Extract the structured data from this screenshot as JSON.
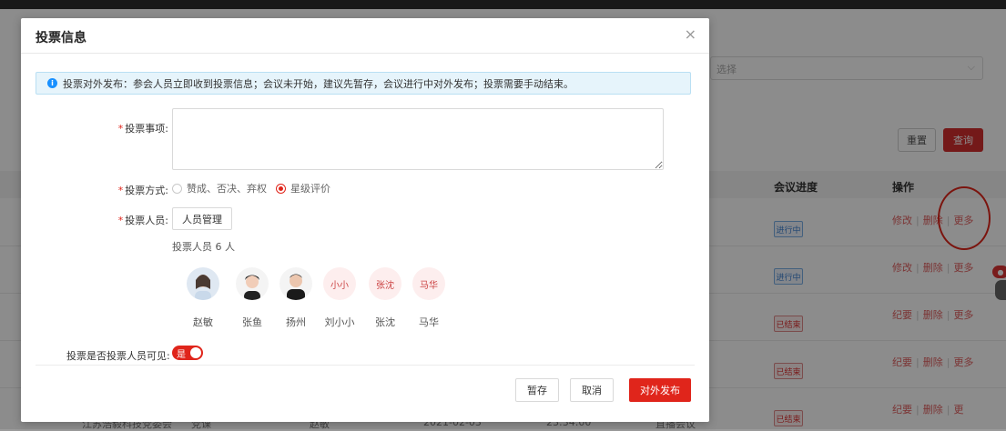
{
  "background": {
    "select_placeholder": "选择",
    "reset_label": "重置",
    "query_label": "查询",
    "columns": {
      "progress": "会议进度",
      "action": "操作"
    },
    "rows": [
      {
        "status": "进行中",
        "actions": [
          "修改",
          "删除",
          "更多"
        ]
      },
      {
        "status": "进行中",
        "actions": [
          "修改",
          "删除",
          "更多"
        ]
      },
      {
        "status": "已结束",
        "actions": [
          "纪要",
          "删除",
          "更多"
        ]
      },
      {
        "status": "已结束",
        "actions": [
          "纪要",
          "删除",
          "更多"
        ]
      },
      {
        "status": "已结束",
        "actions": [
          "纪要",
          "删除",
          "更"
        ]
      }
    ],
    "bottom_row": {
      "org": "江苏浩毅科技党委会",
      "type": "党课",
      "person": "赵敏",
      "date": "2021-02-03",
      "time": "23:34:00",
      "mode": "直播会议"
    }
  },
  "modal": {
    "title": "投票信息",
    "close": "×",
    "alert": "投票对外发布：参会人员立即收到投票信息；会议未开始，建议先暂存，会议进行中对外发布；投票需要手动结束。",
    "fields": {
      "item_label": "投票事项:",
      "method_label": "投票方式:",
      "method_options": [
        "赞成、否决、弃权",
        "星级评价"
      ],
      "method_selected": 1,
      "people_label": "投票人员:",
      "manage_btn": "人员管理",
      "count_text": "投票人员 6 人",
      "visibility_label": "投票是否投票人员可见:",
      "visibility_toggle": "是"
    },
    "people": [
      {
        "avatar": "photo",
        "avatar_text": "",
        "name": "赵敏"
      },
      {
        "avatar": "photo",
        "avatar_text": "",
        "name": "张鱼"
      },
      {
        "avatar": "photo",
        "avatar_text": "",
        "name": "扬州"
      },
      {
        "avatar": "text",
        "avatar_text": "小小",
        "name": "刘小小"
      },
      {
        "avatar": "text",
        "avatar_text": "张沈",
        "name": "张沈"
      },
      {
        "avatar": "text",
        "avatar_text": "马华",
        "name": "马华"
      }
    ],
    "buttons": {
      "save": "暂存",
      "cancel": "取消",
      "publish": "对外发布"
    }
  }
}
